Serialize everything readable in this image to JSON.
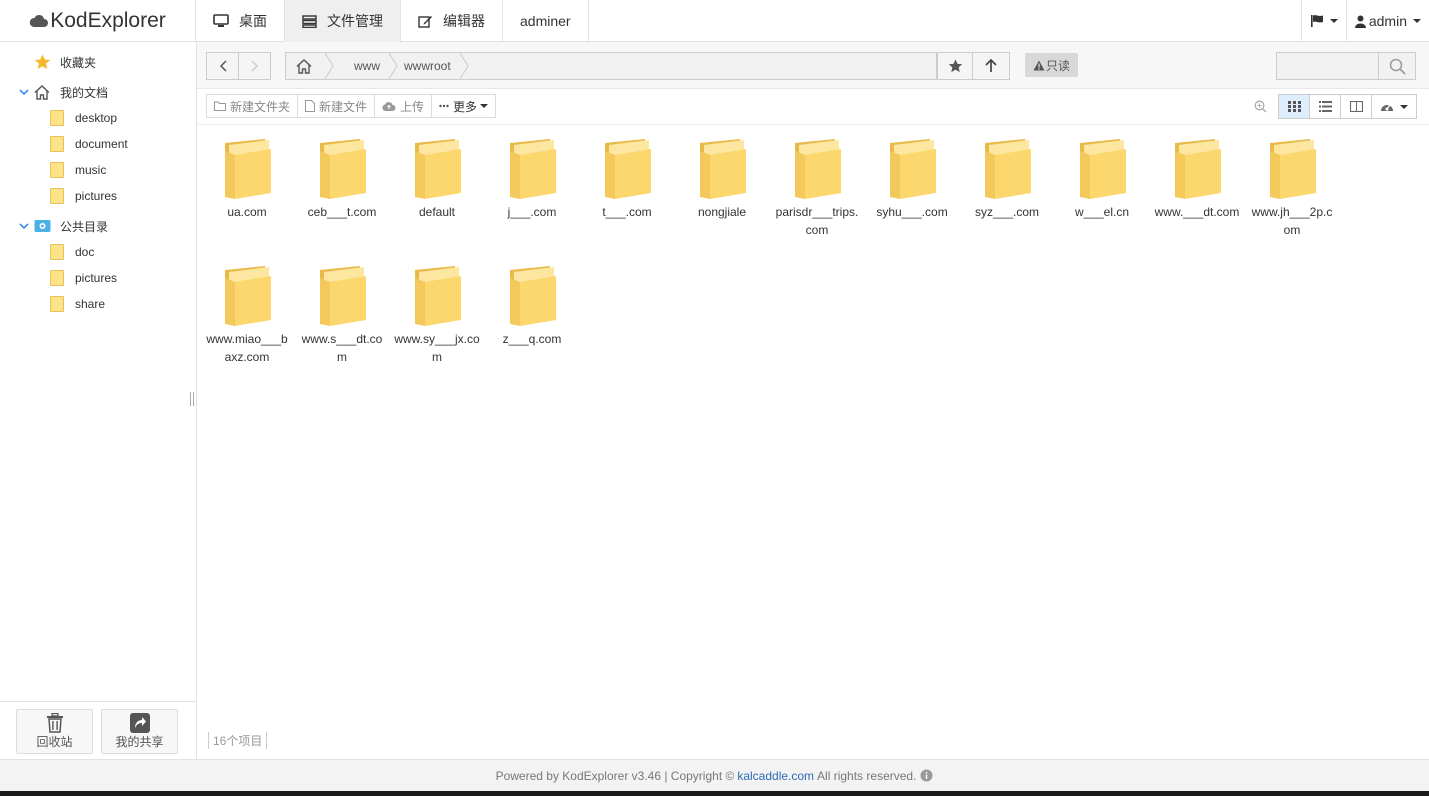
{
  "app": {
    "logo_text": "KodExplorer"
  },
  "topnav": {
    "tabs": [
      {
        "label": "桌面",
        "icon": "desktop-icon"
      },
      {
        "label": "文件管理",
        "icon": "server-icon",
        "active": true
      },
      {
        "label": "编辑器",
        "icon": "edit-icon"
      },
      {
        "label": "adminer"
      }
    ],
    "user": "admin"
  },
  "sidebar": {
    "favorites": "收藏夹",
    "my_docs": "我的文档",
    "my_docs_children": [
      "desktop",
      "document",
      "music",
      "pictures"
    ],
    "public": "公共目录",
    "public_children": [
      "doc",
      "pictures",
      "share"
    ],
    "recycle": "回收站",
    "my_share": "我的共享"
  },
  "path": {
    "crumbs": [
      "www",
      "wwwroot"
    ],
    "readonly": "只读",
    "search_placeholder": ""
  },
  "toolbar": {
    "new_folder": "新建文件夹",
    "new_file": "新建文件",
    "upload": "上传",
    "more": "更多"
  },
  "files": [
    "ua.com",
    "ceb___t.com",
    "default",
    "j___.com",
    "t___.com",
    "nongjiale",
    "parisdr___trips.com",
    "syhu___.com",
    "syz___.com",
    "w___el.cn",
    "www.___dt.com",
    "www.jh___2p.com",
    "www.miao___baxz.com",
    "www.s___dt.com",
    "www.sy___jx.com",
    "z___q.com"
  ],
  "status": {
    "count": "16个项目"
  },
  "footer": {
    "prefix": "Powered by KodExplorer v3.46 | Copyright ©",
    "link": "kalcaddle.com",
    "suffix": "All rights reserved."
  }
}
